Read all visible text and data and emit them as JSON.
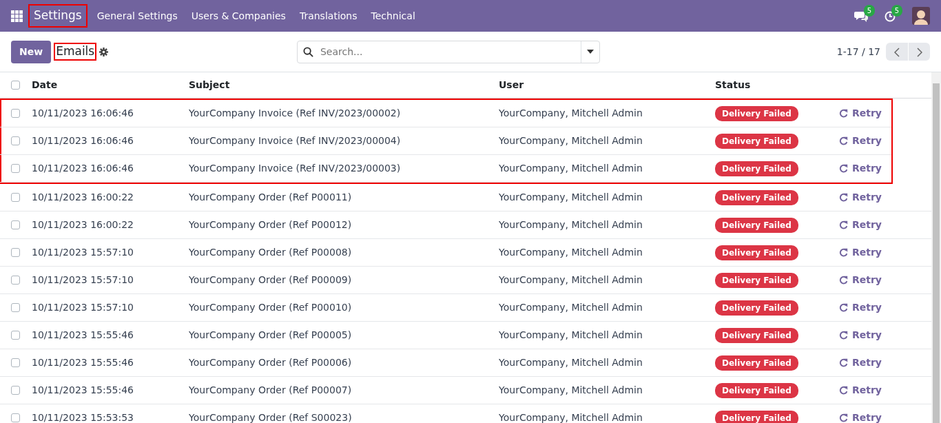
{
  "navbar": {
    "app": "Settings",
    "app_highlighted": true,
    "menus": [
      "General Settings",
      "Users & Companies",
      "Translations",
      "Technical"
    ],
    "messages_count": "5",
    "activities_count": "5"
  },
  "control_panel": {
    "new_button": "New",
    "title": "Emails",
    "title_highlighted": true,
    "search": {
      "placeholder": "Search..."
    },
    "pager": "1-17 / 17"
  },
  "table": {
    "all_checked": false,
    "columns": [
      "Date",
      "Subject",
      "User",
      "Status"
    ],
    "rows": [
      {
        "date": "10/11/2023 16:06:46",
        "subject": "YourCompany Invoice (Ref INV/2023/00002)",
        "user": "YourCompany, Mitchell Admin",
        "status": "Delivery Failed",
        "action": "Retry",
        "checked": false,
        "highlighted": true
      },
      {
        "date": "10/11/2023 16:06:46",
        "subject": "YourCompany Invoice (Ref INV/2023/00004)",
        "user": "YourCompany, Mitchell Admin",
        "status": "Delivery Failed",
        "action": "Retry",
        "checked": false,
        "highlighted": true
      },
      {
        "date": "10/11/2023 16:06:46",
        "subject": "YourCompany Invoice (Ref INV/2023/00003)",
        "user": "YourCompany, Mitchell Admin",
        "status": "Delivery Failed",
        "action": "Retry",
        "checked": false,
        "highlighted": true
      },
      {
        "date": "10/11/2023 16:00:22",
        "subject": "YourCompany Order (Ref P00011)",
        "user": "YourCompany, Mitchell Admin",
        "status": "Delivery Failed",
        "action": "Retry",
        "checked": false,
        "highlighted": false
      },
      {
        "date": "10/11/2023 16:00:22",
        "subject": "YourCompany Order (Ref P00012)",
        "user": "YourCompany, Mitchell Admin",
        "status": "Delivery Failed",
        "action": "Retry",
        "checked": false,
        "highlighted": false
      },
      {
        "date": "10/11/2023 15:57:10",
        "subject": "YourCompany Order (Ref P00008)",
        "user": "YourCompany, Mitchell Admin",
        "status": "Delivery Failed",
        "action": "Retry",
        "checked": false,
        "highlighted": false
      },
      {
        "date": "10/11/2023 15:57:10",
        "subject": "YourCompany Order (Ref P00009)",
        "user": "YourCompany, Mitchell Admin",
        "status": "Delivery Failed",
        "action": "Retry",
        "checked": false,
        "highlighted": false
      },
      {
        "date": "10/11/2023 15:57:10",
        "subject": "YourCompany Order (Ref P00010)",
        "user": "YourCompany, Mitchell Admin",
        "status": "Delivery Failed",
        "action": "Retry",
        "checked": false,
        "highlighted": false
      },
      {
        "date": "10/11/2023 15:55:46",
        "subject": "YourCompany Order (Ref P00005)",
        "user": "YourCompany, Mitchell Admin",
        "status": "Delivery Failed",
        "action": "Retry",
        "checked": false,
        "highlighted": false
      },
      {
        "date": "10/11/2023 15:55:46",
        "subject": "YourCompany Order (Ref P00006)",
        "user": "YourCompany, Mitchell Admin",
        "status": "Delivery Failed",
        "action": "Retry",
        "checked": false,
        "highlighted": false
      },
      {
        "date": "10/11/2023 15:55:46",
        "subject": "YourCompany Order (Ref P00007)",
        "user": "YourCompany, Mitchell Admin",
        "status": "Delivery Failed",
        "action": "Retry",
        "checked": false,
        "highlighted": false
      },
      {
        "date": "10/11/2023 15:53:53",
        "subject": "YourCompany Order (Ref S00023)",
        "user": "YourCompany, Mitchell Admin",
        "status": "Delivery Failed",
        "action": "Retry",
        "checked": false,
        "highlighted": false
      }
    ]
  }
}
